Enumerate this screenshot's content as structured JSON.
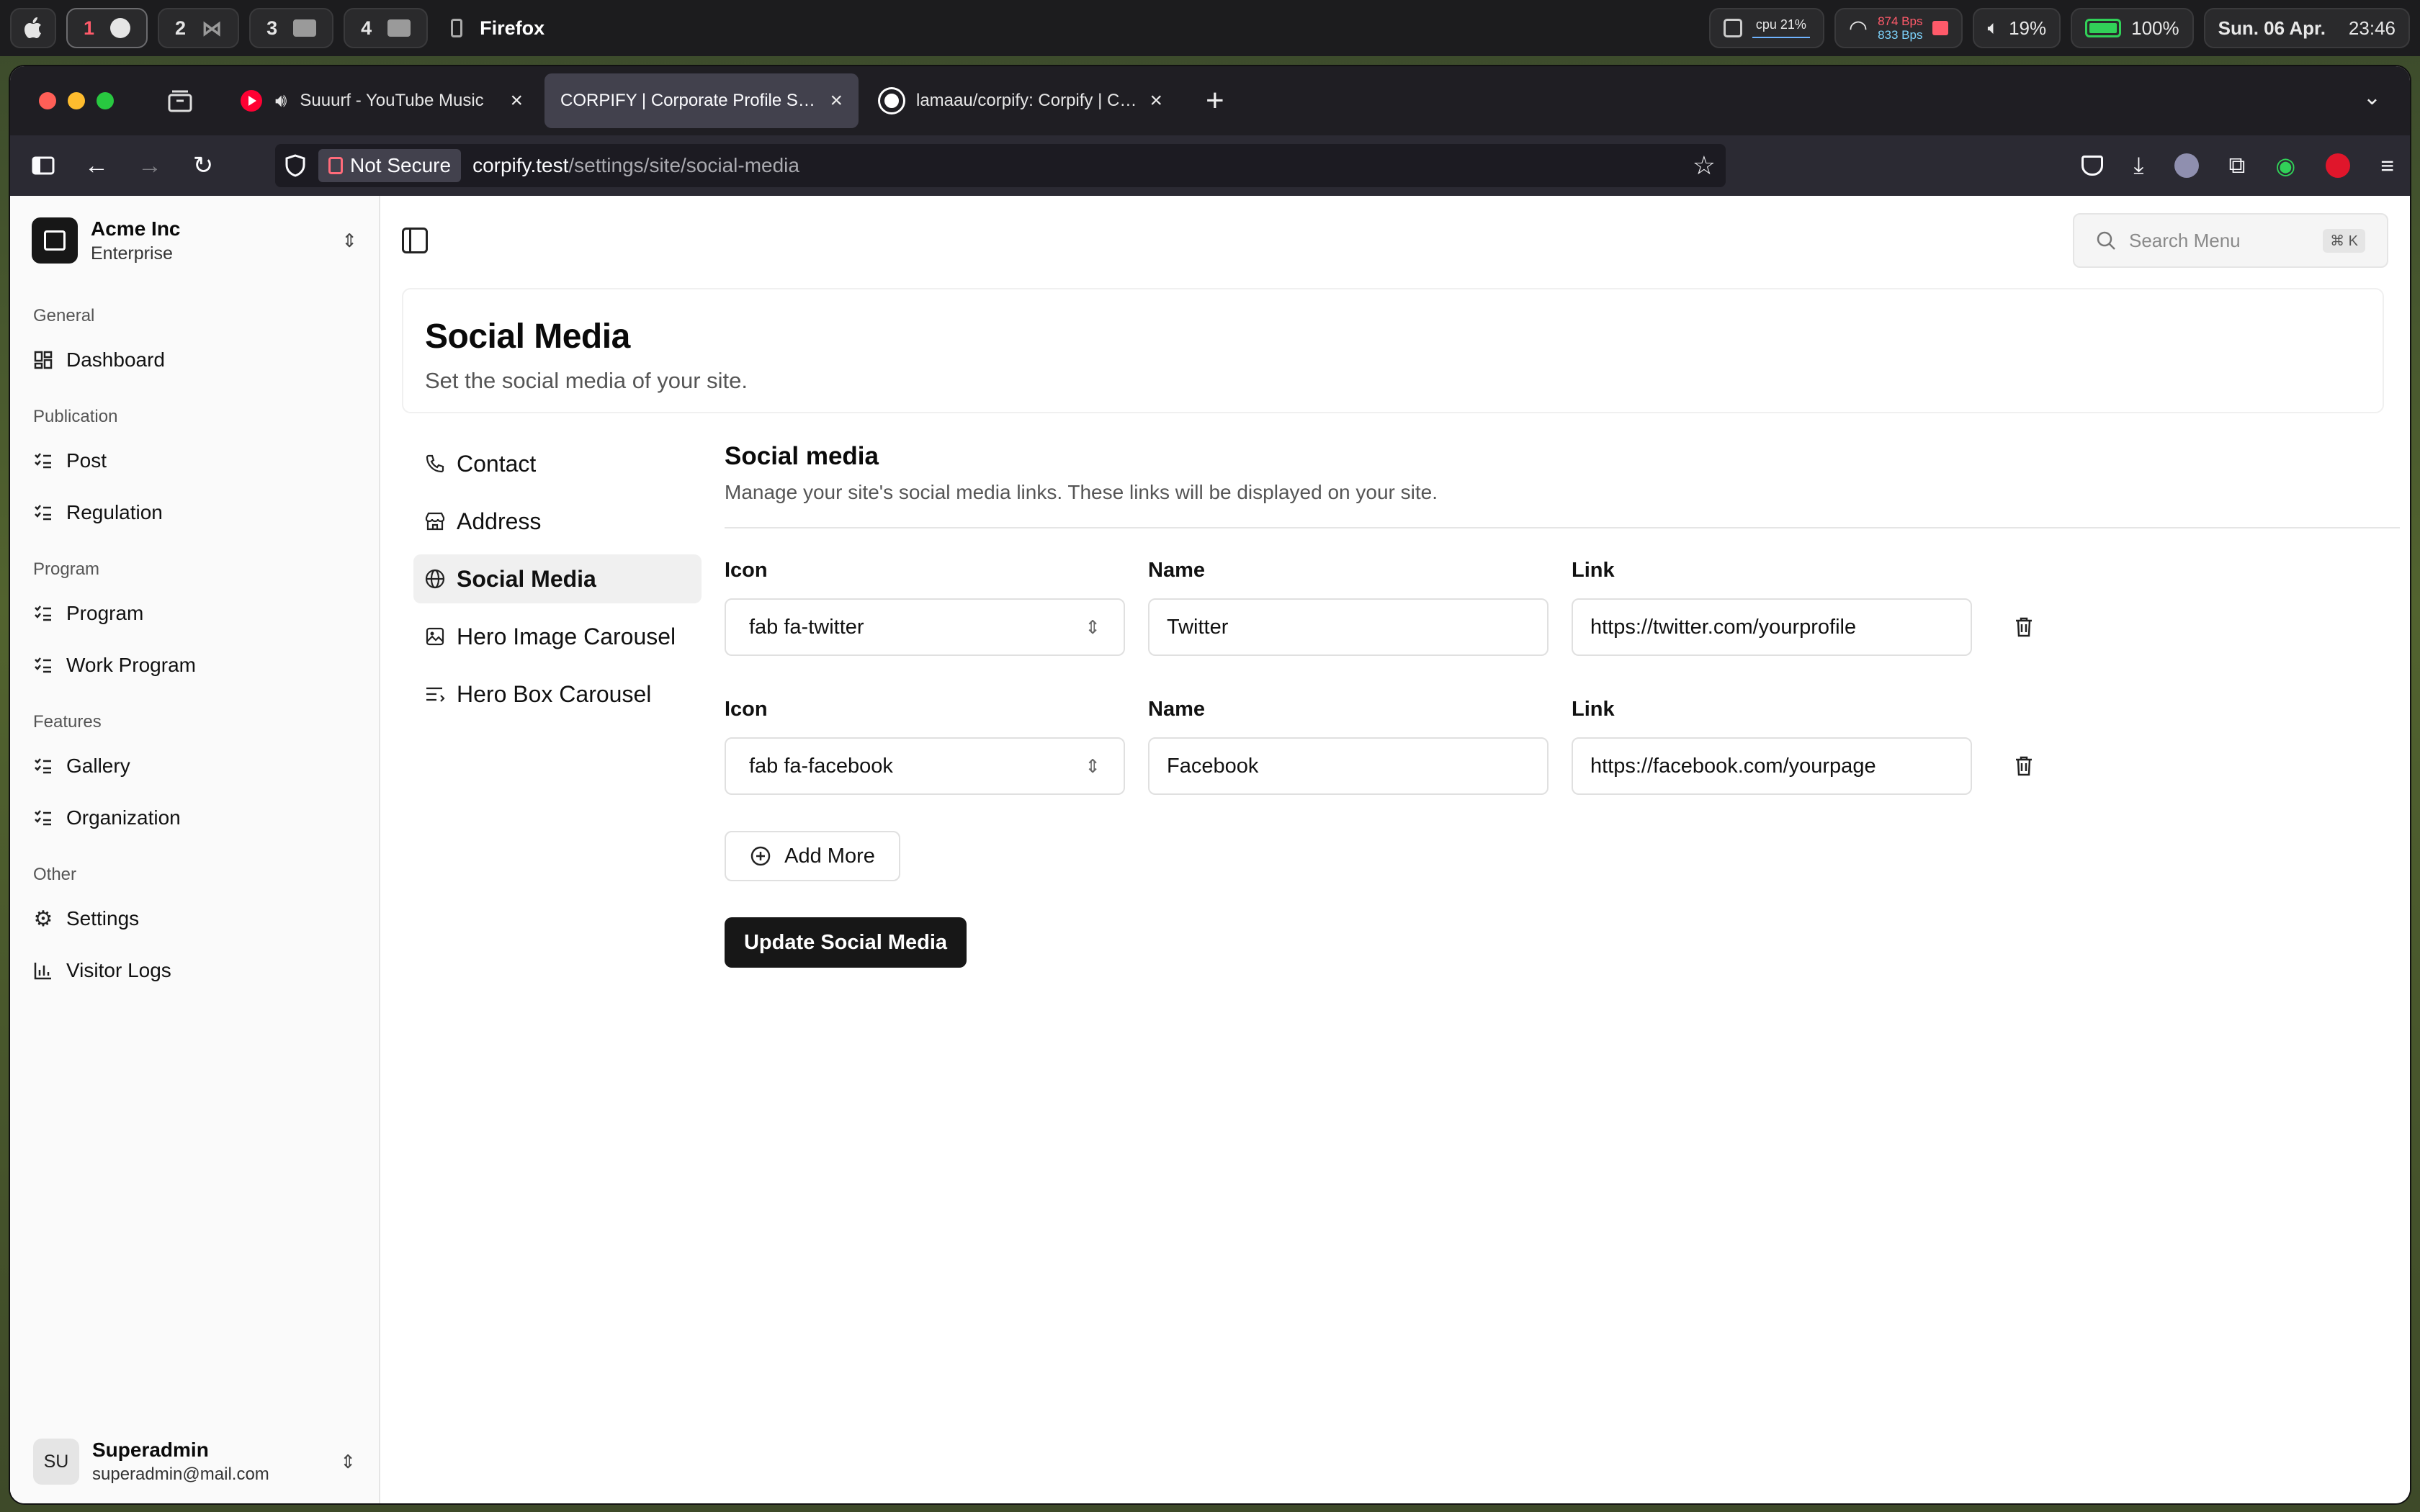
{
  "menubar": {
    "workspaces": [
      "1",
      "2",
      "3",
      "4"
    ],
    "app_name": "Firefox",
    "cpu_label": "cpu 21%",
    "net_up": "874 Bps",
    "net_down": "833 Bps",
    "volume": "19%",
    "battery": "100%",
    "date": "Sun. 06 Apr.",
    "time": "23:46"
  },
  "browser": {
    "tabs": [
      {
        "title": "Suuurf - YouTube Music",
        "icon": "youtube-music-icon"
      },
      {
        "title": "CORPIFY | Corporate Profile Showcase",
        "icon": "none"
      },
      {
        "title": "lamaau/corpify: Corpify | Corporate Profile",
        "icon": "github-icon"
      }
    ],
    "security_label": "Not Secure",
    "url_host": "corpify.test",
    "url_path": "/settings/site/social-media"
  },
  "sidebar": {
    "team_name": "Acme Inc",
    "team_plan": "Enterprise",
    "groups": [
      {
        "label": "General",
        "items": [
          "Dashboard"
        ]
      },
      {
        "label": "Publication",
        "items": [
          "Post",
          "Regulation"
        ]
      },
      {
        "label": "Program",
        "items": [
          "Program",
          "Work Program"
        ]
      },
      {
        "label": "Features",
        "items": [
          "Gallery",
          "Organization"
        ]
      },
      {
        "label": "Other",
        "items": [
          "Settings",
          "Visitor Logs"
        ]
      }
    ],
    "user": {
      "initials": "SU",
      "name": "Superadmin",
      "email": "superadmin@mail.com"
    }
  },
  "topbar": {
    "search_placeholder": "Search Menu",
    "shortcut": "⌘ K"
  },
  "header": {
    "title": "Social Media",
    "subtitle": "Set the social media of your site."
  },
  "subnav": [
    "Contact",
    "Address",
    "Social Media",
    "Hero Image Carousel",
    "Hero Box Carousel"
  ],
  "form": {
    "title": "Social media",
    "description": "Manage your site's social media links. These links will be displayed on your site.",
    "labels": {
      "icon": "Icon",
      "name": "Name",
      "link": "Link"
    },
    "rows": [
      {
        "icon": "fab fa-twitter",
        "name": "Twitter",
        "link": "https://twitter.com/yourprofile"
      },
      {
        "icon": "fab fa-facebook",
        "name": "Facebook",
        "link": "https://facebook.com/yourpage"
      }
    ],
    "add_more_label": "Add More",
    "submit_label": "Update Social Media"
  },
  "colors": {
    "primary_button": "#171717",
    "sidebar_bg": "#fafafa",
    "browser_chrome": "#2b2a33"
  }
}
